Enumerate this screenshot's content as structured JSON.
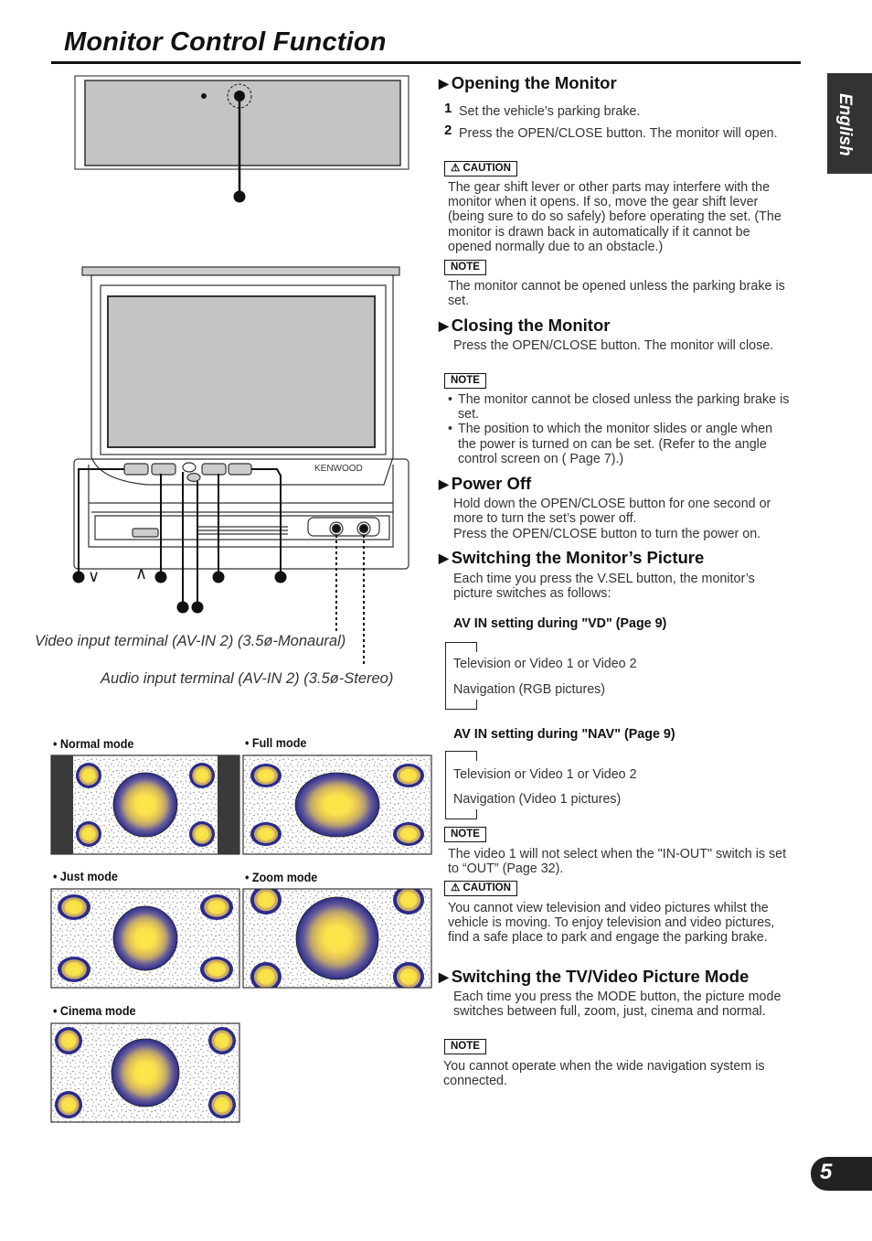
{
  "page_title": "Monitor Control Function",
  "language_tab": "English",
  "page_number": "5",
  "figure": {
    "brand": "KENWOOD",
    "video_terminal_caption": "Video input terminal (AV-IN 2) (3.5ø-Monaural)",
    "audio_terminal_caption": "Audio input terminal (AV-IN 2) (3.5ø-Stereo)",
    "down_symbol": "∨",
    "up_symbol": "∧"
  },
  "modes": [
    {
      "id": "normal",
      "label": "• Normal mode"
    },
    {
      "id": "full",
      "label": "• Full mode"
    },
    {
      "id": "just",
      "label": "• Just mode"
    },
    {
      "id": "zoom",
      "label": "• Zoom mode"
    },
    {
      "id": "cinema",
      "label": "• Cinema mode"
    }
  ],
  "colors": {
    "circle_center": "#fde84a",
    "circle_outer": "#2b2b8c",
    "bars": "#3a3a3a",
    "tab_bg": "#333333"
  },
  "sections": {
    "opening": {
      "heading": "Opening the Monitor",
      "steps": [
        {
          "num": "1",
          "text": "Set the vehicle’s parking brake."
        },
        {
          "num": "2",
          "text": "Press the OPEN/CLOSE button. The monitor will open."
        }
      ],
      "caution_label": "⚠ CAUTION",
      "caution_text": "The gear shift lever or other parts may interfere with the monitor when it opens. If so, move the gear shift lever (being sure to do so safely) before operating the set. (The monitor is drawn back in automatically if it cannot be opened normally due to an obstacle.)",
      "note_label": "NOTE",
      "note_text": "The monitor cannot be opened unless the parking brake is set."
    },
    "closing": {
      "heading": "Closing the Monitor",
      "text": "Press the OPEN/CLOSE button. The monitor will close.",
      "note_label": "NOTE",
      "notes": [
        "The monitor cannot be closed unless the parking brake is set.",
        "The position to which the monitor slides or angle when the power is turned on can be set. (Refer to the angle control screen on ( Page 7).)"
      ]
    },
    "power_off": {
      "heading": "Power Off",
      "text1": "Hold down the OPEN/CLOSE button for one second or more to turn the set’s power off.",
      "text2": "Press the OPEN/CLOSE button to turn the power on."
    },
    "switching_picture": {
      "heading": "Switching the Monitor’s Picture",
      "text": "Each time you press the V.SEL button, the monitor’s picture switches as follows:",
      "vd_heading": "AV IN setting during \"VD\" (Page 9)",
      "vd_items": [
        "Television or Video 1 or Video 2",
        "Navigation (RGB pictures)"
      ],
      "nav_heading": "AV IN setting during \"NAV\" (Page 9)",
      "nav_items": [
        "Television or Video 1 or Video 2",
        "Navigation (Video 1 pictures)"
      ],
      "note_label": "NOTE",
      "note_text": "The video 1 will not select when the \"IN-OUT\" switch is set to “OUT” (Page 32).",
      "caution_label": "⚠ CAUTION",
      "caution_text": "You cannot view television and video pictures whilst the vehicle is moving. To enjoy television and video pictures, find a safe place to park and engage the parking brake."
    },
    "picture_mode": {
      "heading": "Switching the TV/Video Picture Mode",
      "text": "Each time you press the MODE button, the picture mode switches between full, zoom, just, cinema and normal.",
      "note_label": "NOTE",
      "note_text": "You cannot operate when the wide navigation system is connected."
    }
  }
}
